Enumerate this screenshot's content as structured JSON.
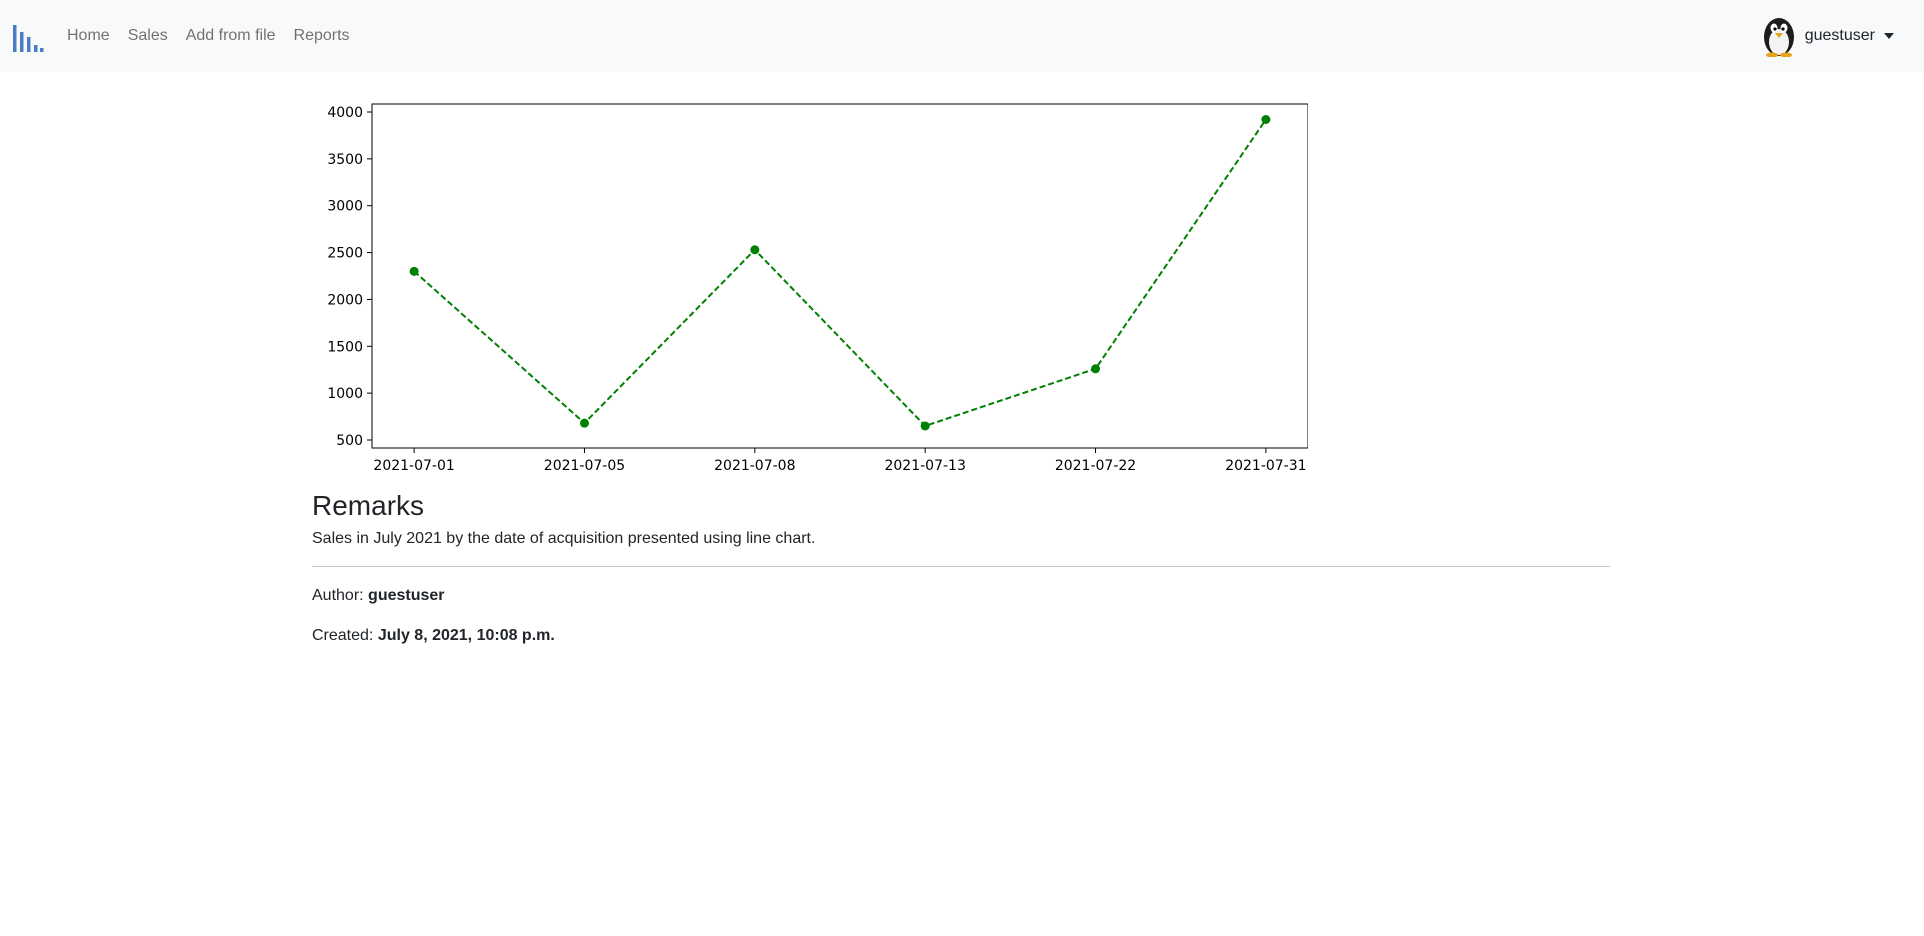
{
  "nav": {
    "logo_icon": "bar-chart-logo-icon",
    "links": [
      "Home",
      "Sales",
      "Add from file",
      "Reports"
    ]
  },
  "user": {
    "avatar_icon": "penguin-avatar-icon",
    "name": "guestuser",
    "dropdown_icon": "caret-down-icon"
  },
  "chart_data": {
    "type": "line",
    "x": [
      "2021-07-01",
      "2021-07-05",
      "2021-07-08",
      "2021-07-13",
      "2021-07-22",
      "2021-07-31"
    ],
    "values": [
      2300,
      680,
      2530,
      650,
      1260,
      3920
    ],
    "ylim": [
      500,
      4000
    ],
    "yticks": [
      500,
      1000,
      1500,
      2000,
      2500,
      3000,
      3500,
      4000
    ],
    "color": "#008000",
    "line_style": "dashed",
    "marker": "circle",
    "grid": false
  },
  "remarks": {
    "title": "Remarks",
    "text": "Sales in July 2021 by the date of acquisition presented using line chart."
  },
  "meta": {
    "author_label": "Author:",
    "author": "guestuser",
    "created_label": "Created:",
    "created": "July 8, 2021, 10:08 p.m."
  }
}
